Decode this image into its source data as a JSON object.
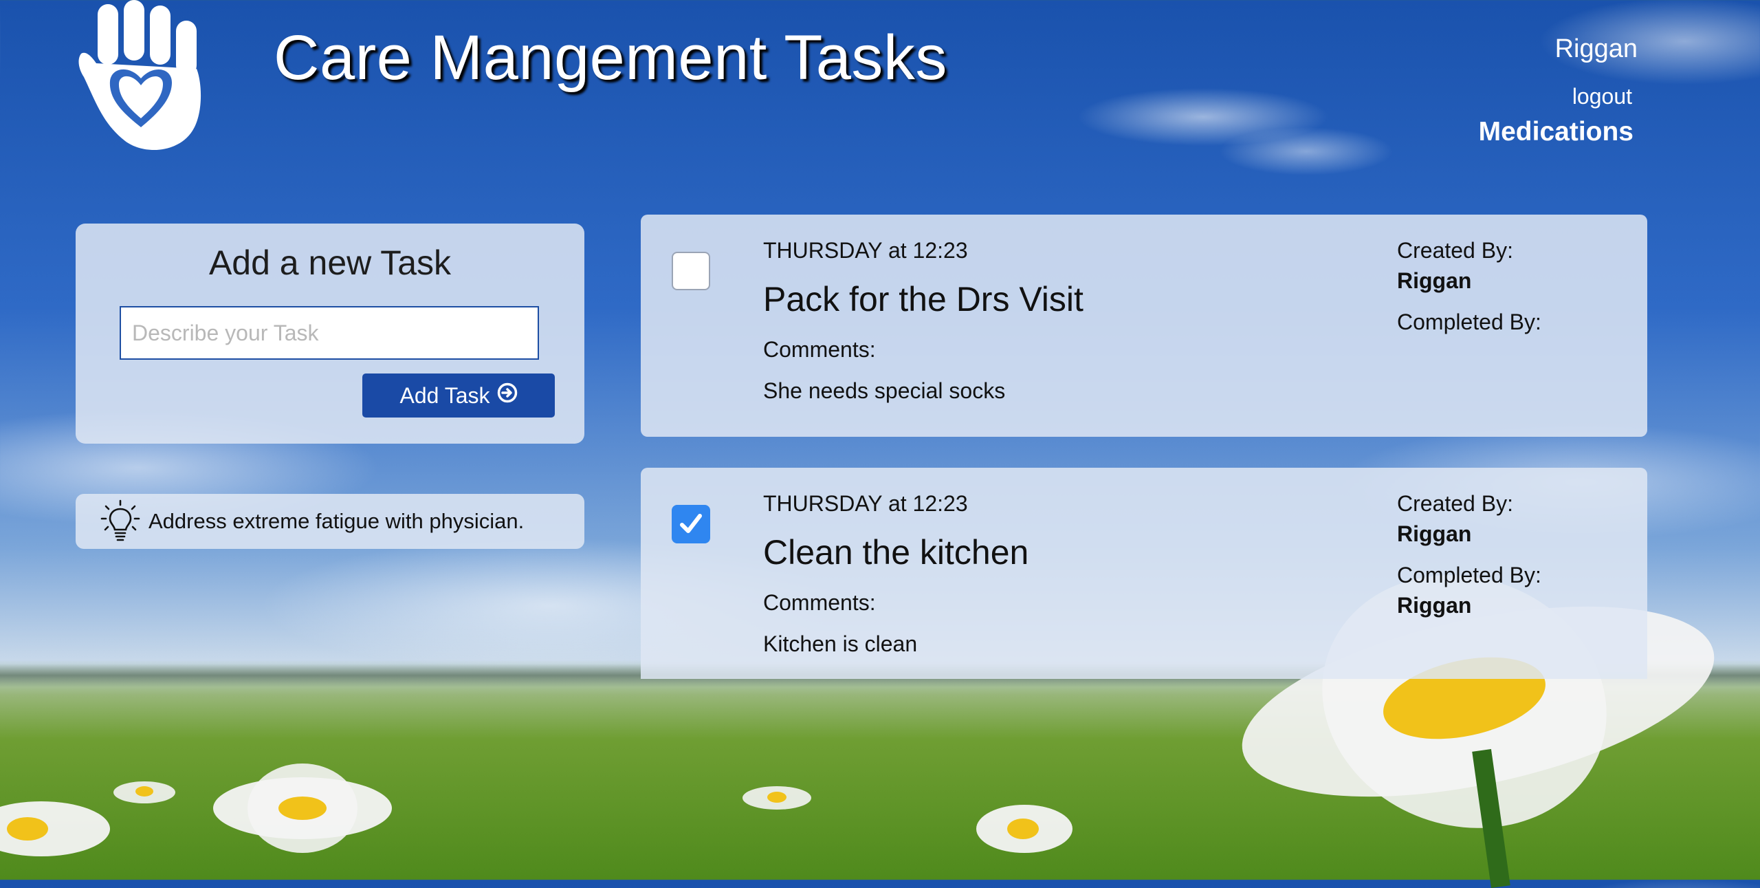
{
  "header": {
    "title": "Care Mangement Tasks",
    "user_name": "Riggan",
    "logout_label": "logout",
    "medications_label": "Medications",
    "logo_icon": "hand-heart-icon"
  },
  "add_task": {
    "title": "Add a new Task",
    "input_placeholder": "Describe your Task",
    "input_value": "",
    "button_label": "Add Task",
    "button_icon": "circle-arrow-right-icon",
    "button_color": "#1a4aa6"
  },
  "tip": {
    "icon": "lightbulb-icon",
    "text": "Address extreme fatigue with physician."
  },
  "tasks": [
    {
      "checked": false,
      "date": "THURSDAY at 12:23",
      "title": "Pack for the Drs Visit",
      "comments_label": "Comments:",
      "comments": "She needs special socks",
      "created_by_label": "Created By:",
      "created_by": "Riggan",
      "completed_by_label": "Completed By:",
      "completed_by": ""
    },
    {
      "checked": true,
      "date": "THURSDAY at 12:23",
      "title": "Clean the kitchen",
      "comments_label": "Comments:",
      "comments": "Kitchen is clean",
      "created_by_label": "Created By:",
      "created_by": "Riggan",
      "completed_by_label": "Completed By:",
      "completed_by": "Riggan"
    }
  ],
  "colors": {
    "checkbox_checked": "#2f86f0",
    "sky": "#1a52ad",
    "grass": "#4f8a1c"
  }
}
